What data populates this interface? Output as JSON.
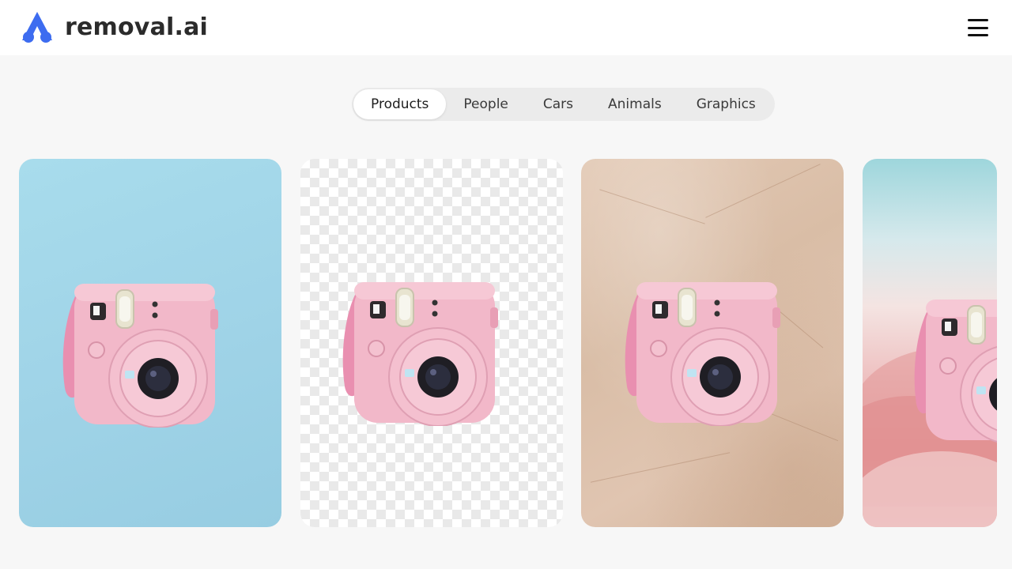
{
  "brand": {
    "name": "removal.ai",
    "logo_color": "#3d6cf0"
  },
  "header": {
    "menu_icon": "hamburger-menu-icon"
  },
  "tabs": [
    {
      "label": "Products",
      "active": true
    },
    {
      "label": "People",
      "active": false
    },
    {
      "label": "Cars",
      "active": false
    },
    {
      "label": "Animals",
      "active": false
    },
    {
      "label": "Graphics",
      "active": false
    }
  ],
  "gallery": {
    "cards": [
      {
        "background": "light blue",
        "subject": "pink instant camera"
      },
      {
        "background": "transparent checkerboard",
        "subject": "pink instant camera"
      },
      {
        "background": "beige stone texture",
        "subject": "pink instant camera"
      },
      {
        "background": "pink misty mountains",
        "subject": "pink instant camera"
      }
    ]
  }
}
